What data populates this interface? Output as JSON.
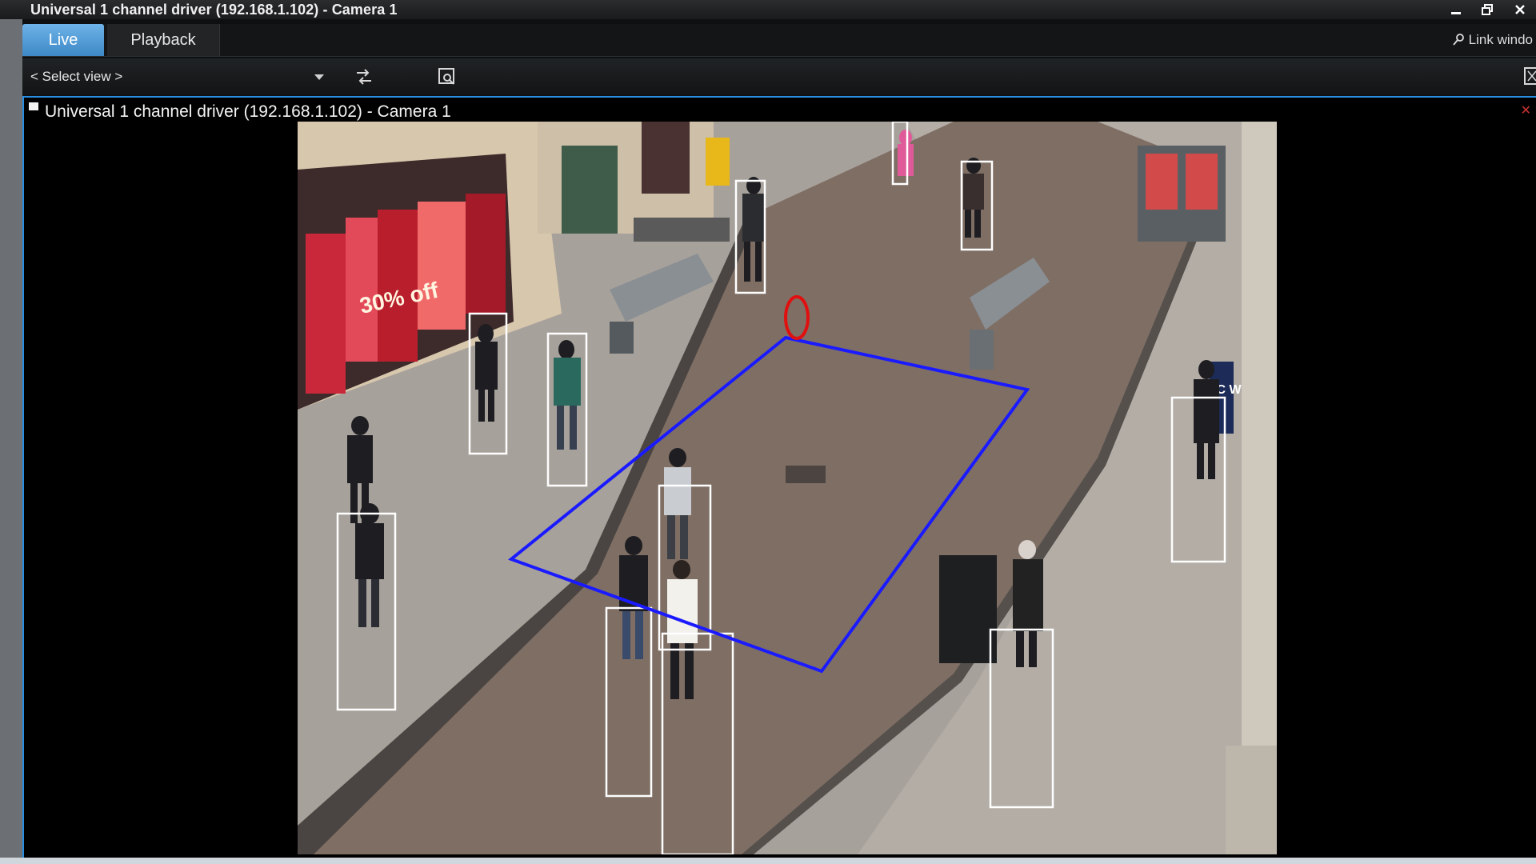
{
  "window": {
    "title": "Universal 1 channel driver (192.168.1.102) - Camera 1",
    "controls": [
      "minimize-icon",
      "restore-icon",
      "close-icon"
    ]
  },
  "tabs": [
    {
      "label": "Live",
      "active": true
    },
    {
      "label": "Playback",
      "active": false
    }
  ],
  "link_window": {
    "label": "Link windo",
    "icon": "link-icon"
  },
  "toolbar": {
    "select_view": "< Select view >",
    "icons": [
      "swap-icon",
      "zoom-window-icon",
      "fullscreen-icon"
    ]
  },
  "camera_view": {
    "title": "Universal 1 channel driver (192.168.1.102) - Camera 1",
    "shop_sign_text": "30% off",
    "signpost_text": "IC W",
    "overlay_colors": {
      "boxes": "#ffffff",
      "zone": "#1a1aff",
      "marker": "#e01010"
    }
  },
  "colors": {
    "accent": "#3d88c6",
    "frame_border": "#2a8ee0"
  }
}
